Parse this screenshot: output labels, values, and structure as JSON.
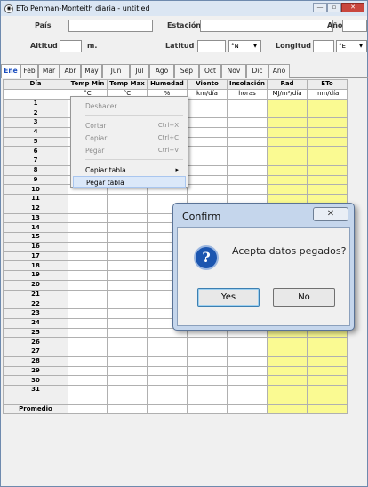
{
  "window": {
    "title": "ETo Penman-Monteith diaria - untitled",
    "min": "—",
    "max": "▫",
    "close": "✕"
  },
  "form": {
    "pais_label": "País",
    "estacion_label": "Estación",
    "anio_label": "Año",
    "altitud_label": "Altitud",
    "altitud_unit": "m.",
    "latitud_label": "Latitud",
    "lat_dir": "°N",
    "longitud_label": "Longitud",
    "lon_dir": "°E"
  },
  "tabs": [
    "Ene",
    "Feb",
    "Mar",
    "Abr",
    "May",
    "Jun",
    "Jul",
    "Ago",
    "Sep",
    "Oct",
    "Nov",
    "Dic",
    "Año"
  ],
  "active_tab": "Ene",
  "table": {
    "headers": [
      "Día",
      "Temp Min",
      "Temp Max",
      "Humedad",
      "Viento",
      "Insolación",
      "Rad",
      "ETo"
    ],
    "units": [
      "",
      "°C",
      "°C",
      "%",
      "km/día",
      "horas",
      "MJ/m²/día",
      "mm/día"
    ],
    "days": [
      "1",
      "2",
      "3",
      "4",
      "5",
      "6",
      "7",
      "8",
      "9",
      "10",
      "11",
      "12",
      "13",
      "14",
      "15",
      "16",
      "17",
      "18",
      "19",
      "20",
      "21",
      "22",
      "23",
      "24",
      "25",
      "26",
      "27",
      "28",
      "29",
      "30",
      "31"
    ],
    "footer": "Promedio"
  },
  "context_menu": {
    "items": [
      {
        "label": "Deshacer",
        "shortcut": "",
        "disabled": true
      },
      {
        "label": "Cortar",
        "shortcut": "Ctrl+X",
        "disabled": true
      },
      {
        "label": "Copiar",
        "shortcut": "Ctrl+C",
        "disabled": true
      },
      {
        "label": "Pegar",
        "shortcut": "Ctrl+V",
        "disabled": true
      },
      {
        "label": "Copiar tabla",
        "shortcut": "▸",
        "disabled": false
      },
      {
        "label": "Pegar tabla",
        "shortcut": "",
        "disabled": false,
        "highlighted": true
      }
    ]
  },
  "dialog": {
    "title": "Confirm",
    "close": "✕",
    "message": "Acepta datos pegados?",
    "icon": "question-icon",
    "yes": "Yes",
    "no": "No"
  },
  "colors": {
    "yellow_column": "#fafa92",
    "active_tab": "#1c4fbf",
    "dialog_frame": "#c5d6ec"
  }
}
